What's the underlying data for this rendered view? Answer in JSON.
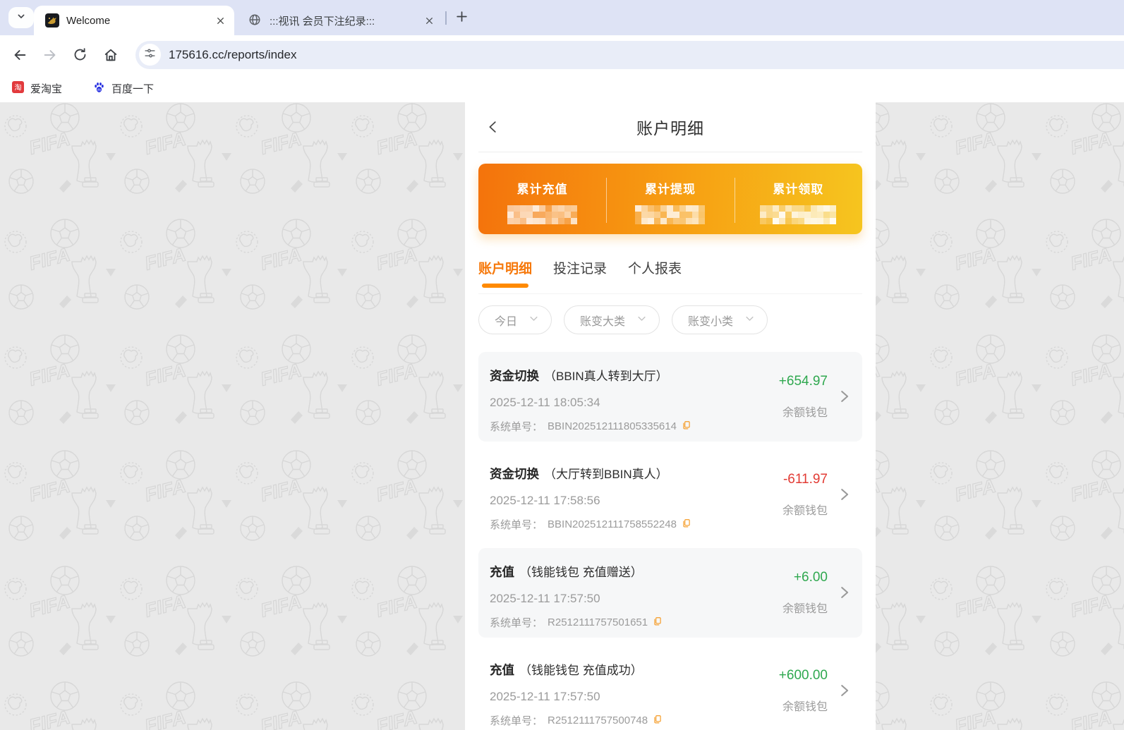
{
  "browser": {
    "tabs": [
      {
        "title": "Welcome",
        "active": true,
        "favicon": "gold-emblem-icon"
      },
      {
        "title": ":::视讯 会员下注纪录:::",
        "active": false,
        "favicon": "globe-icon"
      }
    ],
    "url": "175616.cc/reports/index",
    "bookmarks": [
      {
        "label": "爱淘宝",
        "icon": "taobao-icon"
      },
      {
        "label": "百度一下",
        "icon": "baidu-icon"
      }
    ]
  },
  "page": {
    "header": {
      "title": "账户明细"
    },
    "summary": {
      "stats": [
        {
          "label": "累计充值",
          "value_masked": true
        },
        {
          "label": "累计提现",
          "value_masked": true
        },
        {
          "label": "累计领取",
          "value_masked": true
        }
      ]
    },
    "tabs": [
      {
        "label": "账户明细",
        "active": true
      },
      {
        "label": "投注记录",
        "active": false
      },
      {
        "label": "个人报表",
        "active": false
      }
    ],
    "filters": [
      {
        "label": "今日"
      },
      {
        "label": "账变大类"
      },
      {
        "label": "账变小类"
      }
    ],
    "order_label": "系统单号：",
    "transactions": [
      {
        "type": "资金切换",
        "subtitle": "（BBIN真人转到大厅）",
        "datetime": "2025-12-11 18:05:34",
        "order_no": "BBIN202512111805335614",
        "amount": "+654.97",
        "amount_color": "pos",
        "wallet": "余额钱包"
      },
      {
        "type": "资金切换",
        "subtitle": "（大厅转到BBIN真人）",
        "datetime": "2025-12-11 17:58:56",
        "order_no": "BBIN202512111758552248",
        "amount": "-611.97",
        "amount_color": "neg",
        "wallet": "余额钱包"
      },
      {
        "type": "充值",
        "subtitle": "（钱能钱包 充值赠送）",
        "datetime": "2025-12-11 17:57:50",
        "order_no": "R2512111757501651",
        "amount": "+6.00",
        "amount_color": "pos",
        "wallet": "余额钱包"
      },
      {
        "type": "充值",
        "subtitle": "（钱能钱包 充值成功）",
        "datetime": "2025-12-11 17:57:50",
        "order_no": "R2512111757500748",
        "amount": "+600.00",
        "amount_color": "pos",
        "wallet": "余额钱包"
      }
    ]
  },
  "colors": {
    "accent_orange": "#f6790c",
    "underline_orange": "#ff8a00",
    "gradient_from": "#f4730c",
    "gradient_to": "#f6c51f",
    "positive_green": "#2fa84f",
    "negative_red": "#e23b34",
    "tabstrip_bg": "#dee3f5",
    "omnibox_bg": "#e9edf8"
  }
}
